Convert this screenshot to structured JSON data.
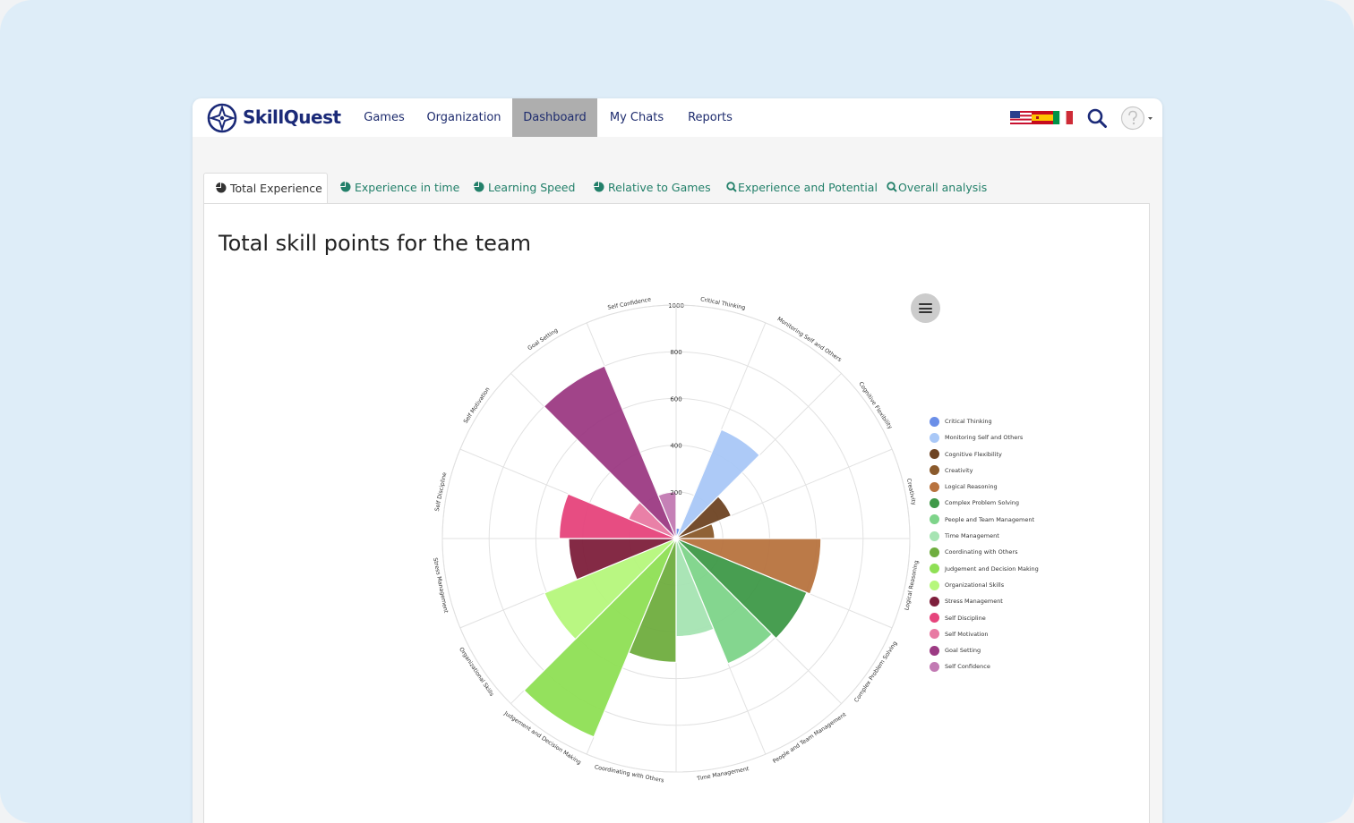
{
  "header": {
    "brand": "SkillQuest",
    "nav": [
      {
        "label": "Games",
        "active": false
      },
      {
        "label": "Organization",
        "active": false
      },
      {
        "label": "Dashboard",
        "active": true
      },
      {
        "label": "My Chats",
        "active": false
      },
      {
        "label": "Reports",
        "active": false
      }
    ],
    "icons": {
      "languages": "language-flags-icon",
      "search": "search-icon",
      "user": "avatar-icon"
    }
  },
  "tabs": [
    {
      "label": "Total Experience",
      "icon": "pie-icon",
      "active": true
    },
    {
      "label": "Experience in time",
      "icon": "pie-icon",
      "active": false
    },
    {
      "label": "Learning Speed",
      "icon": "pie-icon",
      "active": false
    },
    {
      "label": "Relative to Games",
      "icon": "pie-icon",
      "active": false
    },
    {
      "label": "Experience and Potential",
      "icon": "search-icon",
      "active": false
    },
    {
      "label": "Overall analysis",
      "icon": "search-icon",
      "active": false
    }
  ],
  "panel": {
    "title": "Total skill points for the team"
  },
  "chart_data": {
    "type": "polar-bar",
    "title": "Total skill points for the team",
    "categories": [
      "Critical Thinking",
      "Monitoring Self and Others",
      "Cognitive Flexibility",
      "Creativity",
      "Logical Reasoning",
      "Complex Problem Solving",
      "People and Team Management",
      "Time Management",
      "Coordinating with Others",
      "Judgement and Decision Making",
      "Organizational Skills",
      "Stress Management",
      "Self Discipline",
      "Self Motivation",
      "Goal Setting",
      "Self Confidence"
    ],
    "values": [
      45,
      505,
      255,
      165,
      620,
      605,
      580,
      420,
      530,
      920,
      610,
      460,
      500,
      220,
      800,
      200
    ],
    "colors": [
      "#6b8fe8",
      "#a9c8f7",
      "#6e4423",
      "#8a5a2c",
      "#b8733f",
      "#3f9948",
      "#7ed48a",
      "#a6e4b3",
      "#6fad3f",
      "#8fe055",
      "#b6f77c",
      "#7e1f3c",
      "#e6447c",
      "#e87aa3",
      "#9c3a83",
      "#c27ab3"
    ],
    "yaxis": {
      "min": 0,
      "max": 1000,
      "ticks": [
        200,
        400,
        600,
        800,
        1000
      ]
    },
    "legend_position": "right",
    "grid": true
  }
}
